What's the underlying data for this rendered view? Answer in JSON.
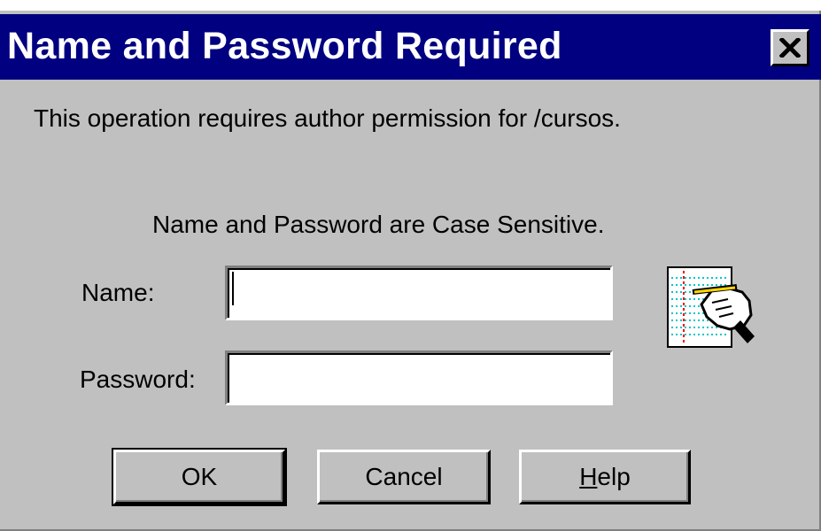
{
  "window": {
    "title": "Name and Password Required",
    "close_label": "✕"
  },
  "message": "This operation requires author permission for /cursos.",
  "case_note": "Name and Password are Case Sensitive.",
  "fields": {
    "name_label": "Name:",
    "name_value": "",
    "password_label": "Password:",
    "password_value": ""
  },
  "buttons": {
    "ok": "OK",
    "cancel": "Cancel",
    "help_hotkey": "H",
    "help_rest": "elp"
  },
  "icons": {
    "credentials": "notepad-pen-hand-icon"
  },
  "colors": {
    "titlebar": "#000080",
    "face": "#c0c0c0"
  }
}
